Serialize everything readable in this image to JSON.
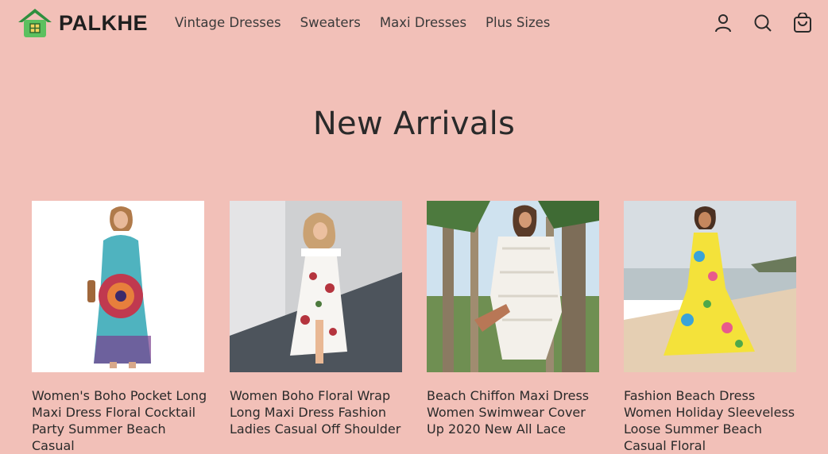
{
  "brand": {
    "name": "PALKHE"
  },
  "nav": {
    "items": [
      {
        "label": "Vintage Dresses"
      },
      {
        "label": "Sweaters"
      },
      {
        "label": "Maxi Dresses"
      },
      {
        "label": "Plus Sizes"
      }
    ]
  },
  "header_icons": [
    "account-icon",
    "search-icon",
    "cart-icon"
  ],
  "section": {
    "title": "New Arrivals"
  },
  "products": [
    {
      "title": "Women's Boho Pocket Long Maxi Dress Floral Cocktail Party Summer Beach Casual"
    },
    {
      "title": "Women Boho Floral Wrap Long Maxi Dress Fashion Ladies Casual Off Shoulder"
    },
    {
      "title": "Beach Chiffon Maxi Dress Women Swimwear Cover Up 2020 New All Lace"
    },
    {
      "title": "Fashion Beach Dress Women Holiday Sleeveless Loose Summer Beach Casual Floral"
    }
  ],
  "colors": {
    "background": "#f2c0b8",
    "logo_green": "#3aa84a",
    "text": "#2b2b2b"
  }
}
